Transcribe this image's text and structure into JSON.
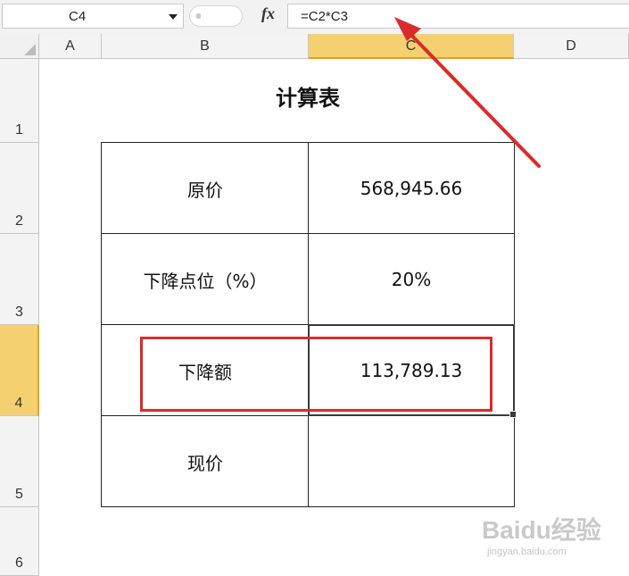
{
  "formula_bar": {
    "name_box": "C4",
    "fx_label": "fx",
    "formula": "=C2*C3"
  },
  "columns": [
    "A",
    "B",
    "C",
    "D"
  ],
  "rows": [
    "1",
    "2",
    "3",
    "4",
    "5",
    "6"
  ],
  "selected_cell": {
    "column": "C",
    "row": "4"
  },
  "sheet": {
    "title": "计算表",
    "table": [
      {
        "label": "原价",
        "value": "568,945.66"
      },
      {
        "label": "下降点位（%）",
        "value": "20%"
      },
      {
        "label": "下降额",
        "value": "113,789.13"
      },
      {
        "label": "现价",
        "value": ""
      }
    ]
  },
  "colors": {
    "selected_header": "#f5d070",
    "highlight_box": "#d92b2b",
    "arrow": "#d92b2b"
  },
  "watermark": {
    "brand": "Baidu经验",
    "url": "jingyan.baidu.com"
  }
}
